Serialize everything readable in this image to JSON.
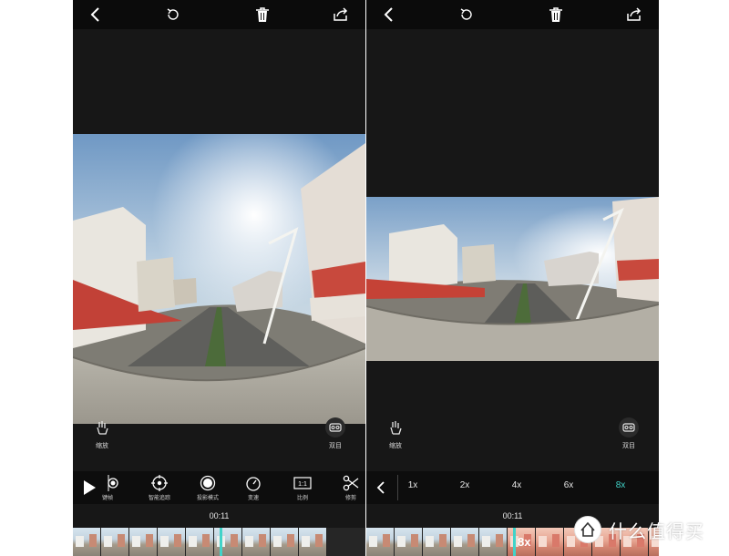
{
  "icons": {
    "back": "chevron-left-icon",
    "undo": "undo-icon",
    "trash": "trash-icon",
    "share": "share-icon",
    "zoom": "hand-pinch-icon",
    "vr": "vr-goggles-icon",
    "play": "play-icon",
    "keyframe": "keyframe-icon",
    "tracking": "target-icon",
    "projection": "sphere-icon",
    "speed": "speedometer-icon",
    "ratio": "ratio-icon",
    "trim": "scissors-icon"
  },
  "left": {
    "zoom_label": "缩放",
    "vr_label": "双目",
    "tools": [
      {
        "label": "键帧"
      },
      {
        "label": "智能追踪"
      },
      {
        "label": "投影模式"
      },
      {
        "label": "变速"
      },
      {
        "label": "比例",
        "badge": "1:1"
      },
      {
        "label": "修剪"
      }
    ],
    "time": "00:11",
    "playhead_progress": 0.5
  },
  "right": {
    "zoom_label": "缩放",
    "vr_label": "双目",
    "speeds": [
      "1x",
      "2x",
      "4x",
      "6x",
      "8x"
    ],
    "active_speed": "8x",
    "time": "00:11",
    "playhead_label": "8x",
    "playhead_progress": 0.5
  },
  "watermark": {
    "badge": "值",
    "text": "什么值得买"
  },
  "colors": {
    "accent": "#41d3c9",
    "background": "#171717",
    "bar": "#0d0d0d"
  }
}
